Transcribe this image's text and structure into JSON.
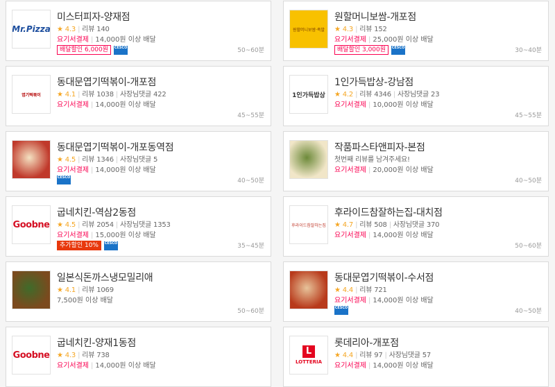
{
  "restaurants": [
    {
      "name": "미스터피자-양재점",
      "rating": "4.3",
      "review": "리뷰 140",
      "owner": "",
      "desc": "",
      "payment": "요기서결제",
      "min_order": "14,000원 이상 배달",
      "promo": "배달할인 6,000원",
      "promo_style": "outline",
      "cesco": true,
      "time": "50~60분",
      "logo": "mrpizza",
      "logo_text": "Mr.Pizza"
    },
    {
      "name": "원할머니보쌈-개포점",
      "rating": "4.3",
      "review": "리뷰 152",
      "owner": "",
      "desc": "",
      "payment": "요기서결제",
      "min_order": "25,000원 이상 배달",
      "promo": "배달할인 3,000원",
      "promo_style": "outline",
      "cesco": true,
      "time": "30~40분",
      "logo": "won",
      "logo_text": "원할머니보쌈·족발"
    },
    {
      "name": "동대문엽기떡볶이-개포점",
      "rating": "4.1",
      "review": "리뷰 1038",
      "owner": "사장님댓글 422",
      "desc": "",
      "payment": "요기서결제",
      "min_order": "14,000원 이상 배달",
      "promo": "",
      "promo_style": "",
      "cesco": false,
      "time": "45~55분",
      "logo": "yupki",
      "logo_text": "엽기떡볶이"
    },
    {
      "name": "1인가득밥상-강남점",
      "rating": "4.2",
      "review": "리뷰 4346",
      "owner": "사장님댓글 23",
      "desc": "",
      "payment": "요기서결제",
      "min_order": "10,000원 이상 배달",
      "promo": "",
      "promo_style": "",
      "cesco": false,
      "time": "45~55분",
      "logo": "gadeuk",
      "logo_text": "1인가득밥상"
    },
    {
      "name": "동대문엽기떡볶이-개포동역점",
      "rating": "4.5",
      "review": "리뷰 1346",
      "owner": "사장님댓글 5",
      "desc": "",
      "payment": "요기서결제",
      "min_order": "14,000원 이상 배달",
      "promo": "",
      "promo_style": "",
      "cesco": true,
      "time": "40~50분",
      "logo": "photo-tteok",
      "logo_text": ""
    },
    {
      "name": "작품파스타앤피자-본점",
      "rating": "",
      "review": "",
      "owner": "",
      "desc": "첫번째 리뷰를 남겨주세요!",
      "payment": "요기서결제",
      "min_order": "20,000원 이상 배달",
      "promo": "",
      "promo_style": "",
      "cesco": false,
      "time": "40~50분",
      "logo": "photo-pasta",
      "logo_text": ""
    },
    {
      "name": "굽네치킨-역삼2동점",
      "rating": "4.5",
      "review": "리뷰 2054",
      "owner": "사장님댓글 1353",
      "desc": "",
      "payment": "요기서결제",
      "min_order": "15,000원 이상 배달",
      "promo": "추가할인 10%",
      "promo_style": "solid",
      "cesco": true,
      "time": "35~45분",
      "logo": "goobne",
      "logo_text": "Goobne"
    },
    {
      "name": "후라이드참잘하는집-대치점",
      "rating": "4.7",
      "review": "리뷰 508",
      "owner": "사장님댓글 370",
      "desc": "",
      "payment": "요기서결제",
      "min_order": "14,000원 이상 배달",
      "promo": "",
      "promo_style": "",
      "cesco": false,
      "time": "50~60분",
      "logo": "fried",
      "logo_text": "후라이드참잘하는집"
    },
    {
      "name": "일본식돈까스냉모밀리애",
      "rating": "4.1",
      "review": "리뷰 1069",
      "owner": "",
      "desc": "",
      "payment": "",
      "min_order": "7,500원 이상 배달",
      "promo": "",
      "promo_style": "",
      "cesco": false,
      "time": "50~60분",
      "logo": "photo-katsu",
      "logo_text": ""
    },
    {
      "name": "동대문엽기떡볶이-수서점",
      "rating": "4.4",
      "review": "리뷰 721",
      "owner": "",
      "desc": "",
      "payment": "요기서결제",
      "min_order": "14,000원 이상 배달",
      "promo": "",
      "promo_style": "",
      "cesco": true,
      "time": "40~50분",
      "logo": "photo-tteok2",
      "logo_text": ""
    },
    {
      "name": "굽네치킨-양재1동점",
      "rating": "4.3",
      "review": "리뷰 738",
      "owner": "",
      "desc": "",
      "payment": "요기서결제",
      "min_order": "14,000원 이상 배달",
      "promo": "",
      "promo_style": "",
      "cesco": false,
      "time": "",
      "logo": "goobne",
      "logo_text": "Goobne"
    },
    {
      "name": "롯데리아-개포점",
      "rating": "4.4",
      "review": "리뷰 97",
      "owner": "사장님댓글 57",
      "desc": "",
      "payment": "요기서결제",
      "min_order": "14,000원 이상 배달",
      "promo": "",
      "promo_style": "",
      "cesco": false,
      "time": "",
      "logo": "lotteria",
      "logo_text": "LOTTERIA"
    }
  ],
  "cesco_label": "CESCO",
  "star_glyph": "★",
  "colors": {
    "accent": "#fa0050",
    "star": "#f5a623",
    "promo_solid": "#e8380d",
    "cesco": "#1a73c8"
  }
}
